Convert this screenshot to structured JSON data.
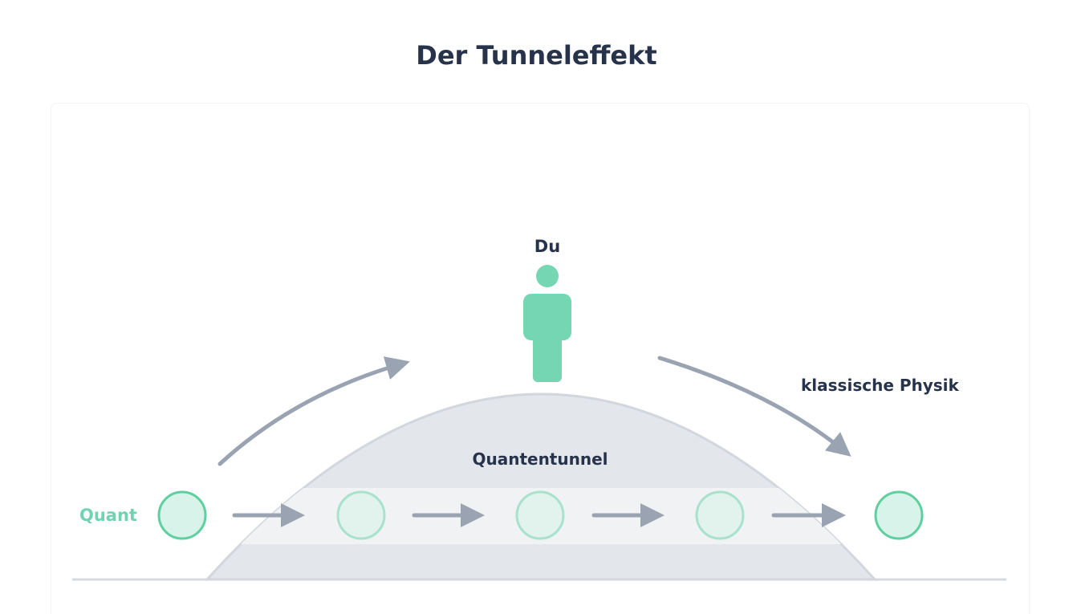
{
  "title": "Der Tunneleffekt",
  "labels": {
    "person": "Du",
    "classical": "klassische Physik",
    "tunnel": "Quantentunnel",
    "particle": "Quant"
  },
  "colors": {
    "title": "#27334a",
    "accent_green": "#74d6b3",
    "particle_fill": "#d8f4ea",
    "particle_stroke": "#5fcf9f",
    "hill": "#e3e6eb",
    "hill_edge": "#d2d6dd",
    "tunnel_band": "#f1f2f4",
    "arrow": "#9aa3b1",
    "ground": "#d6d9de"
  },
  "icons": [
    "person-icon",
    "arrow-right-icon",
    "curved-arrow-icon",
    "particle-circle-icon"
  ]
}
